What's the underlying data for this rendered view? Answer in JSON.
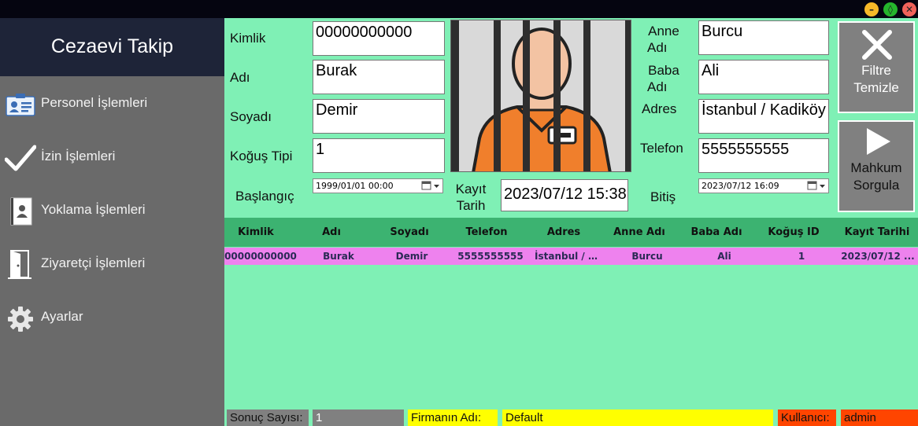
{
  "window": {
    "min_symbol": "–",
    "max_symbol": "◊",
    "close_symbol": "✕"
  },
  "sidebar": {
    "title": "Cezaevi Takip",
    "items": [
      {
        "label": "Personel İşlemleri",
        "icon": "id-card-icon"
      },
      {
        "label": "İzin İşlemleri",
        "icon": "checkmark-icon"
      },
      {
        "label": "Yoklama İşlemleri",
        "icon": "clipboard-person-icon"
      },
      {
        "label": "Ziyaretçi İşlemleri",
        "icon": "door-icon"
      },
      {
        "label": "Ayarlar",
        "icon": "gear-icon"
      }
    ]
  },
  "form": {
    "kimlik_label": "Kimlik",
    "kimlik_value": "00000000000",
    "adi_label": "Adı",
    "adi_value": "Burak",
    "soyadi_label": "Soyadı",
    "soyadi_value": "Demir",
    "kogus_label": "Koğuş Tipi",
    "kogus_value": "1",
    "baslangic_label": "Başlangıç",
    "baslangic_value": "1999/01/01 00:00",
    "kayit_label_1": "Kayıt",
    "kayit_label_2": "Tarih",
    "kayit_value": "2023/07/12 15:38",
    "anne_label_1": "Anne",
    "anne_label_2": "Adı",
    "anne_value": "Burcu",
    "baba_label_1": "Baba",
    "baba_label_2": "Adı",
    "baba_value": "Ali",
    "adres_label": "Adres",
    "adres_value": "İstanbul / Kadiköy",
    "telefon_label": "Telefon",
    "telefon_value": "5555555555",
    "bitis_label": "Bitiş",
    "bitis_value": "2023/07/12 16:09"
  },
  "buttons": {
    "filter_clear_1": "Filtre",
    "filter_clear_2": "Temizle",
    "query_1": "Mahkum",
    "query_2": "Sorgula"
  },
  "table": {
    "columns": [
      "Kimlik",
      "Adı",
      "Soyadı",
      "Telefon",
      "Adres",
      "Anne Adı",
      "Baba Adı",
      "Koğuş ID",
      "Kayıt Tarihi"
    ],
    "rows": [
      [
        "00000000000",
        "Burak",
        "Demir",
        "5555555555",
        "İstanbul / K...",
        "Burcu",
        "Ali",
        "1",
        "2023/07/12 ..."
      ]
    ]
  },
  "status": {
    "count_label": "Sonuç Sayısı:",
    "count_value": "1",
    "firm_label": "Firmanın Adı:",
    "firm_value": "Default",
    "user_label": "Kullanıcı:",
    "user_value": "admin"
  },
  "colors": {
    "background": "#7ff0b5",
    "sidebar": "#6a6a6a",
    "brand": "#1e2438",
    "header": "#3cb371",
    "selected_row": "#ee82ee",
    "status_gray": "#808080",
    "status_yellow": "#ffff00",
    "status_red": "#ff4500"
  }
}
